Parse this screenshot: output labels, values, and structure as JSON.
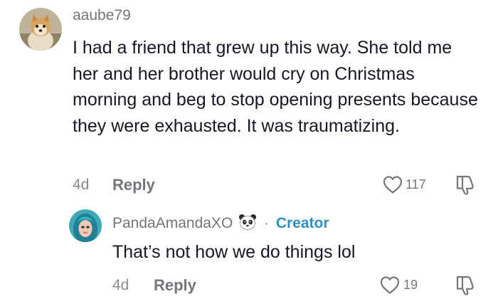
{
  "comments": [
    {
      "username": "aaube79",
      "text": "I had a friend that grew up this way. She told me her and her brother would cry on Christmas morning and beg to stop opening presents because they were exhausted. It was traumatizing.",
      "time": "4d",
      "reply_label": "Reply",
      "likes": "117"
    },
    {
      "username": "PandaAmandaXO",
      "separator": "·",
      "badge": "Creator",
      "text": "That’s not how we do things lol",
      "time": "4d",
      "reply_label": "Reply",
      "likes": "19"
    }
  ],
  "icons": {
    "like": "heart-outline-icon",
    "dislike": "thumbs-down-outline-icon",
    "username_emoji": "panda-face-icon"
  },
  "colors": {
    "username": "#75767b",
    "creator_badge": "#2f8fc8",
    "text": "#161823"
  }
}
